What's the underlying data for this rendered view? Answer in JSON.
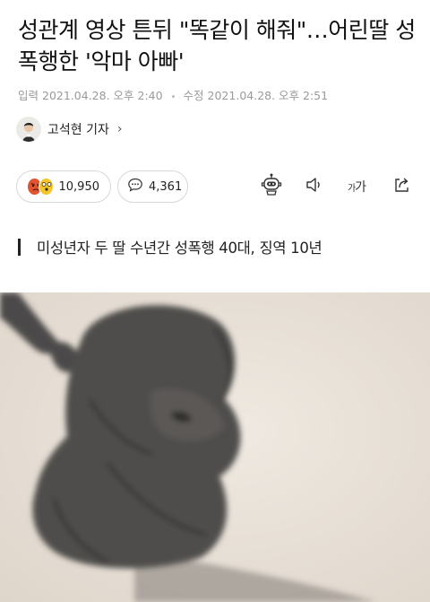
{
  "article": {
    "headline": "성관계 영상 튼뒤 \"똑같이 해줘\"…어린딸 성폭행한 '악마 아빠'",
    "published_label": "입력",
    "published_time": "2021.04.28. 오후 2:40",
    "modified_label": "수정",
    "modified_time": "2021.04.28. 오후 2:51",
    "author": "고석현 기자",
    "author_chevron": "›",
    "subheadline": "미성년자 두 딸 수년간 성폭행 40대, 징역 10년"
  },
  "toolbar": {
    "reaction_count": "10,950",
    "comment_count": "4,361",
    "font_size_label_small": "가",
    "font_size_label_large": "가"
  },
  "icons": {
    "reactions": [
      "angry-emoji-icon",
      "surprised-emoji-icon"
    ],
    "comment": "speech-bubble-icon",
    "tools": [
      "robot-summary-icon",
      "speaker-icon",
      "font-size-icon",
      "share-icon"
    ]
  },
  "colors": {
    "background": "#ffffff",
    "text": "#111111",
    "meta_text": "#9a9a9a",
    "angry_emoji": "#e2532f",
    "surprised_emoji": "#f5c52a",
    "illustration_background": "#e9e2d9",
    "illustration_figure": "#4f4e4c"
  }
}
